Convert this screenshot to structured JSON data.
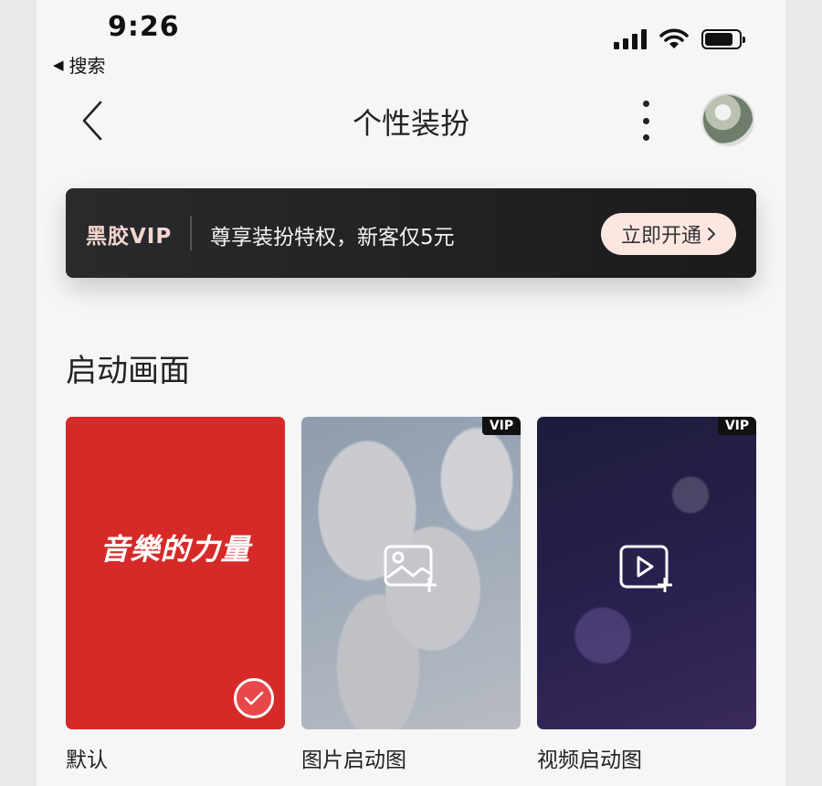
{
  "status_bar": {
    "time": "9:26",
    "back_app_label": "搜索"
  },
  "nav": {
    "title": "个性装扮"
  },
  "vip_banner": {
    "logo_text": "黑胶VIP",
    "promo_text": "尊享装扮特权，新客仅5元",
    "button_label": "立即开通"
  },
  "section": {
    "title": "启动画面",
    "cards": [
      {
        "label": "默认",
        "slogan": "音樂的力量",
        "selected": true
      },
      {
        "label": "图片启动图",
        "badge": "VIP"
      },
      {
        "label": "视频启动图",
        "badge": "VIP"
      }
    ]
  },
  "icons": {
    "back": "chevron-left-icon",
    "more": "more-vertical-icon",
    "image_add": "image-add-icon",
    "video_add": "video-add-icon",
    "check": "check-icon"
  },
  "colors": {
    "default_card": "#d62a29",
    "vip_button_bg": "#fbe6e0",
    "banner_bg": "#1b1b1d",
    "check_bg": "#e8484a"
  }
}
